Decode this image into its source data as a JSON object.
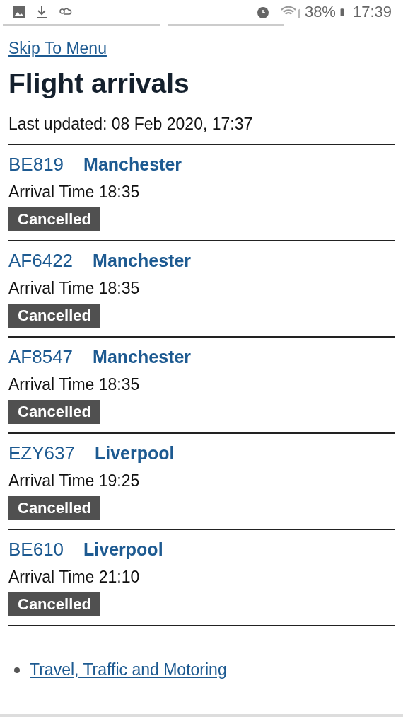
{
  "status_bar": {
    "battery": "38%",
    "time": "17:39"
  },
  "skip_link": "Skip To Menu",
  "title": "Flight arrivals",
  "last_updated": "Last updated: 08 Feb 2020, 17:37",
  "flights": [
    {
      "code": "BE819",
      "origin": "Manchester",
      "arrival": "Arrival Time 18:35",
      "status": "Cancelled"
    },
    {
      "code": "AF6422",
      "origin": "Manchester",
      "arrival": "Arrival Time 18:35",
      "status": "Cancelled"
    },
    {
      "code": "AF8547",
      "origin": "Manchester",
      "arrival": "Arrival Time 18:35",
      "status": "Cancelled"
    },
    {
      "code": "EZY637",
      "origin": "Liverpool",
      "arrival": "Arrival Time 19:25",
      "status": "Cancelled"
    },
    {
      "code": "BE610",
      "origin": "Liverpool",
      "arrival": "Arrival Time 21:10",
      "status": "Cancelled"
    }
  ],
  "footer_links": [
    "Travel, Traffic and Motoring"
  ]
}
